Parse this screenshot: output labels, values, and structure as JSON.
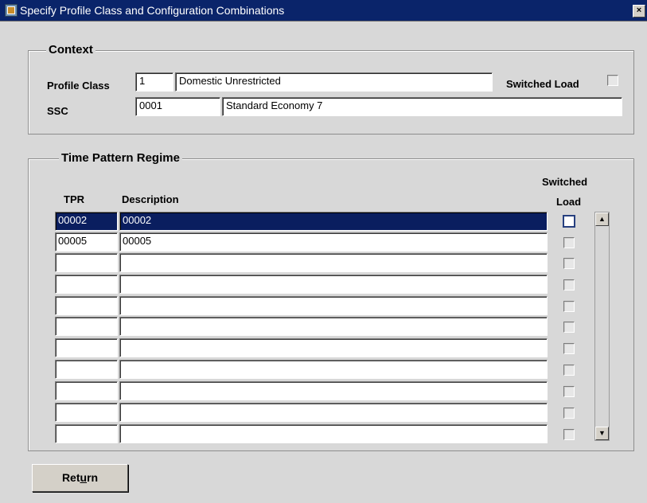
{
  "window": {
    "title": "Specify Profile Class and Configuration Combinations",
    "close_symbol": "×"
  },
  "context": {
    "title": "Context",
    "profile_class_label": "Profile Class",
    "profile_class_code": "1",
    "profile_class_description": "Domestic Unrestricted",
    "switched_load_label": "Switched Load",
    "switched_load_checked": false,
    "ssc_label": "SSC",
    "ssc_code": "0001",
    "ssc_description": "Standard Economy 7"
  },
  "time_pattern_regime": {
    "title": "Time Pattern Regime",
    "columns": {
      "tpr": "TPR",
      "description": "Description",
      "switched_load_line1": "Switched",
      "switched_load_line2": "Load"
    },
    "rows": [
      {
        "tpr": "00002",
        "description": "00002",
        "switched_load": false,
        "selected": true
      },
      {
        "tpr": "00005",
        "description": "00005",
        "switched_load": false,
        "selected": false
      },
      {
        "tpr": "",
        "description": "",
        "switched_load": false,
        "selected": false
      },
      {
        "tpr": "",
        "description": "",
        "switched_load": false,
        "selected": false
      },
      {
        "tpr": "",
        "description": "",
        "switched_load": false,
        "selected": false
      },
      {
        "tpr": "",
        "description": "",
        "switched_load": false,
        "selected": false
      },
      {
        "tpr": "",
        "description": "",
        "switched_load": false,
        "selected": false
      },
      {
        "tpr": "",
        "description": "",
        "switched_load": false,
        "selected": false
      },
      {
        "tpr": "",
        "description": "",
        "switched_load": false,
        "selected": false
      },
      {
        "tpr": "",
        "description": "",
        "switched_load": false,
        "selected": false
      },
      {
        "tpr": "",
        "description": "",
        "switched_load": false,
        "selected": false
      }
    ]
  },
  "buttons": {
    "return_label_prefix": "Ret",
    "return_label_mnemonic": "u",
    "return_label_suffix": "rn"
  },
  "icons": {
    "app_icon": "forms-window-icon",
    "close_icon": "close-icon",
    "scroll_up_icon": "scroll-up-icon",
    "scroll_down_icon": "scroll-down-icon"
  }
}
